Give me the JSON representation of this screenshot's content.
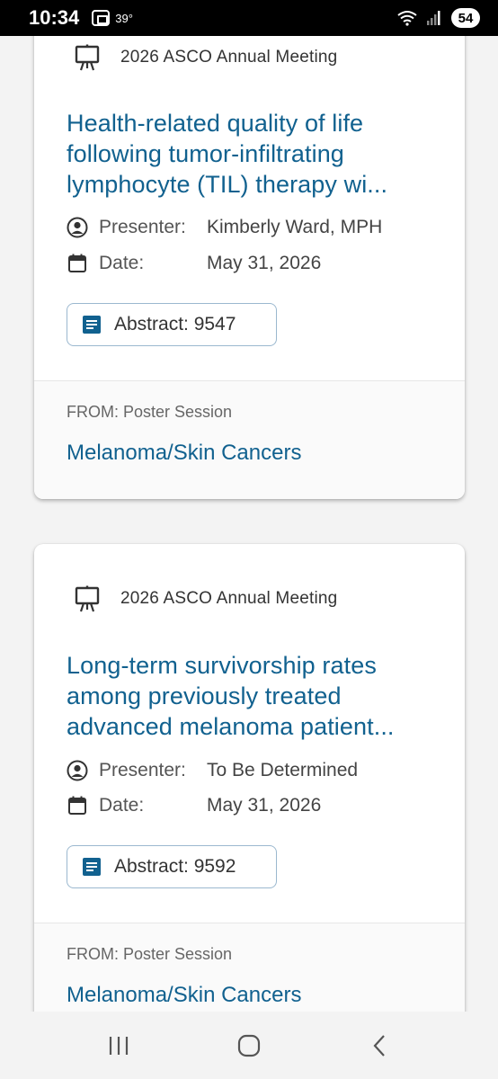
{
  "status_bar": {
    "time": "10:34",
    "temperature": "39°",
    "battery": "54",
    "icons": [
      "screen-record-icon",
      "wifi-icon",
      "signal-icon"
    ]
  },
  "cards": [
    {
      "meeting": "2026 ASCO Annual Meeting",
      "title_lines": [
        "Health-related quality of life",
        "following tumor-infiltrating",
        "lymphocyte (TIL) therapy wi..."
      ],
      "presenter_label": "Presenter:",
      "presenter": "Kimberly Ward, MPH",
      "date_label": "Date:",
      "date": "May 31, 2026",
      "abstract": "Abstract: 9547",
      "from": "FROM: Poster Session",
      "session": "Melanoma/Skin Cancers"
    },
    {
      "meeting": "2026 ASCO Annual Meeting",
      "title_lines": [
        "Long-term survivorship rates",
        "among previously treated",
        "advanced melanoma patient..."
      ],
      "presenter_label": "Presenter:",
      "presenter": "To Be Determined",
      "date_label": "Date:",
      "date": "May 31, 2026",
      "abstract": "Abstract: 9592",
      "from": "FROM: Poster Session",
      "session": "Melanoma/Skin Cancers"
    }
  ],
  "nav_bar": {
    "buttons": [
      "recent-apps-icon",
      "home-icon",
      "back-icon"
    ]
  },
  "colors": {
    "accent": "#11618f",
    "text": "#444444",
    "background": "#f3f3f3"
  }
}
